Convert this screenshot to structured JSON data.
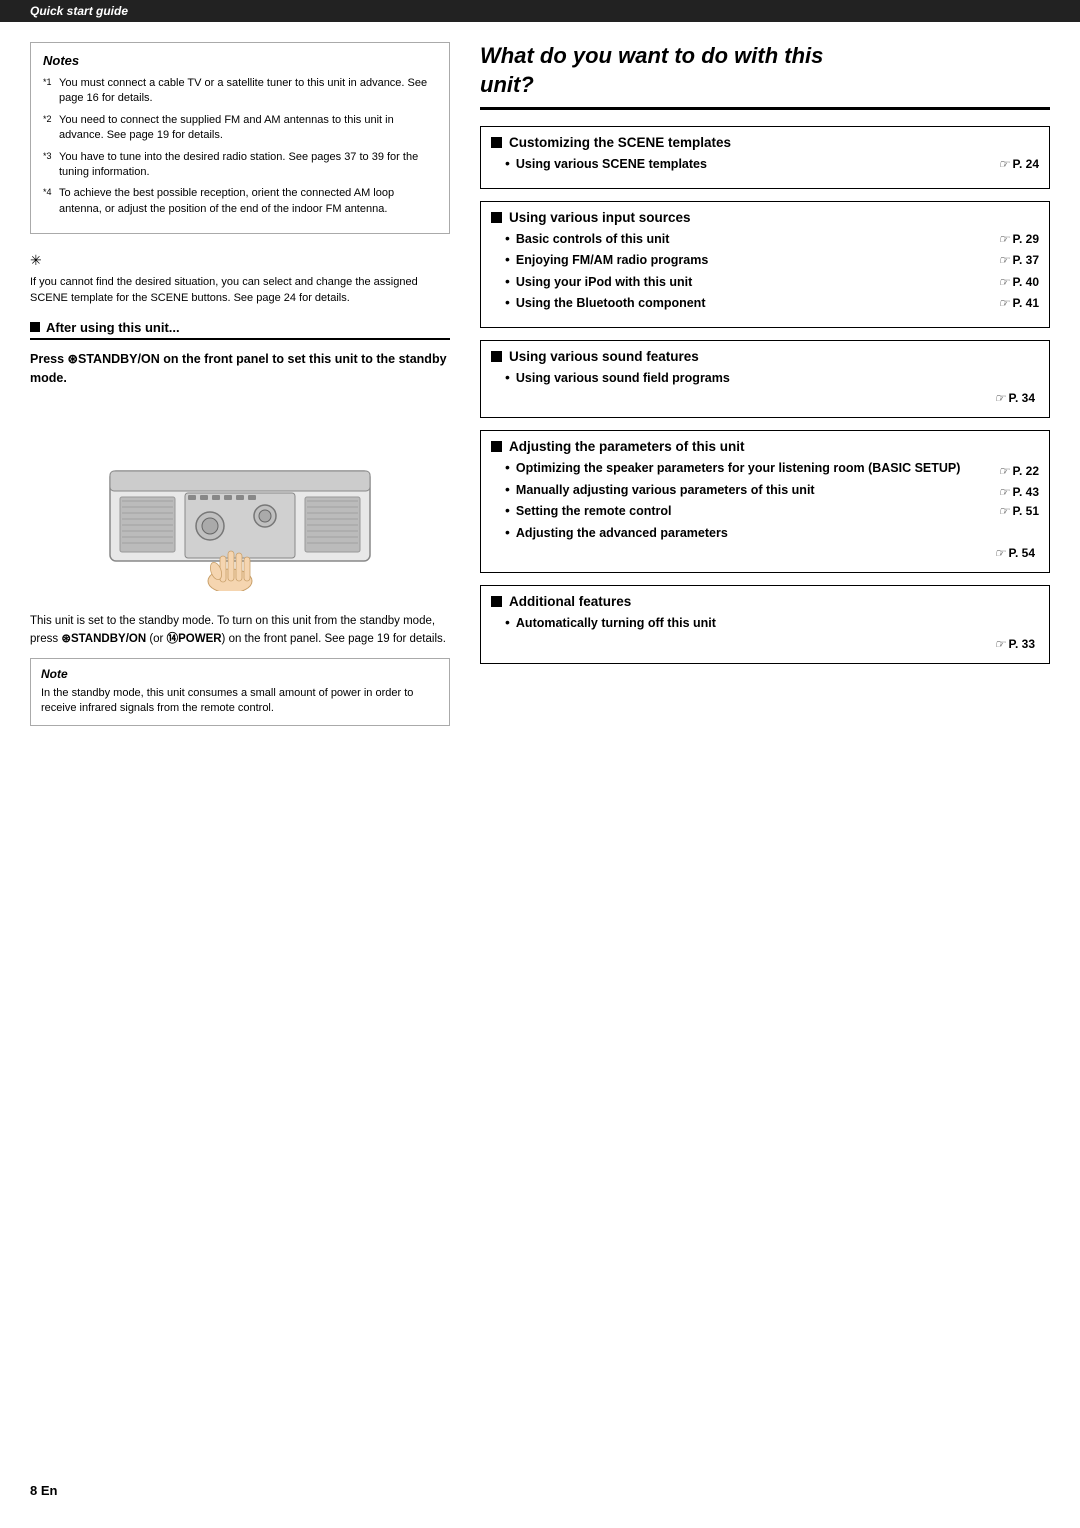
{
  "header": {
    "label": "Quick start guide"
  },
  "left": {
    "notes_title": "Notes",
    "notes": [
      {
        "sup": "*1",
        "text": "You must connect a cable TV or a satellite tuner to this unit in advance. See page 16 for details."
      },
      {
        "sup": "*2",
        "text": "You need to connect the supplied FM and AM antennas to this unit in advance. See page 19 for details."
      },
      {
        "sup": "*3",
        "text": "You have to tune into the desired radio station. See pages 37 to 39 for the tuning information."
      },
      {
        "sup": "*4",
        "text": "To achieve the best possible reception, orient the connected AM loop antenna, or adjust the position of the end of the indoor FM antenna."
      }
    ],
    "tip_symbol": "✳",
    "tip_text": "If you cannot find the desired situation, you can select and change the assigned SCENE template for the SCENE buttons. See page 24 for details.",
    "after_title": "After using this unit...",
    "standby_instruction": "Press  STANDBY/ON on the front panel to set this unit to the standby mode.",
    "standby_desc1": "This unit is set to the standby mode. To turn on this unit from the standby mode, press ",
    "standby_desc2": "STANDBY/ON",
    "standby_desc3": " (or ",
    "standby_desc4": "POWER",
    "standby_desc5": ") on the front panel. See page 19 for details.",
    "note_title": "Note",
    "note_text": "In the standby mode, this unit consumes a small amount of power in order to receive infrared signals from the remote control."
  },
  "right": {
    "heading_line1": "What do you want to do with this",
    "heading_line2": "unit?",
    "sections": [
      {
        "id": "scene",
        "header": "Customizing the SCENE templates",
        "bullets": [
          {
            "text": "Using various SCENE templates",
            "ref": "P. 24",
            "inline": true
          }
        ]
      },
      {
        "id": "input",
        "header": "Using various input sources",
        "bullets": [
          {
            "text": "Basic controls of this unit",
            "ref": "P. 29",
            "inline": true
          },
          {
            "text": "Enjoying FM/AM radio programs",
            "ref": "P. 37",
            "inline": true
          },
          {
            "text": "Using your iPod with this unit",
            "ref": "P. 40",
            "inline": true
          },
          {
            "text": "Using the Bluetooth component",
            "ref": "P. 41",
            "inline": true
          }
        ]
      },
      {
        "id": "sound",
        "header": "Using various sound features",
        "bullets": [
          {
            "text": "Using various sound field programs",
            "ref": "P. 34",
            "inline": false
          }
        ]
      },
      {
        "id": "params",
        "header": "Adjusting the parameters of this unit",
        "bullets": [
          {
            "text1": "Optimizing the speaker parameters for your",
            "text2": "listening room (BASIC SETUP)",
            "ref": "P. 22",
            "multiline": true
          },
          {
            "text1": "Manually adjusting various parameters of",
            "text2": "this unit",
            "ref": "P. 43",
            "multiline": true
          },
          {
            "text": "Setting the remote control",
            "ref": "P. 51",
            "inline": true
          },
          {
            "text1": "Adjusting the advanced parameters",
            "ref": "P. 54",
            "multiline": false,
            "refbelow": true
          }
        ]
      },
      {
        "id": "additional",
        "header": "Additional features",
        "bullets": [
          {
            "text1": "Automatically turning off this unit",
            "ref": "P. 33",
            "multiline": false,
            "refbelow": true
          }
        ]
      }
    ]
  },
  "footer": {
    "page": "8 En"
  }
}
